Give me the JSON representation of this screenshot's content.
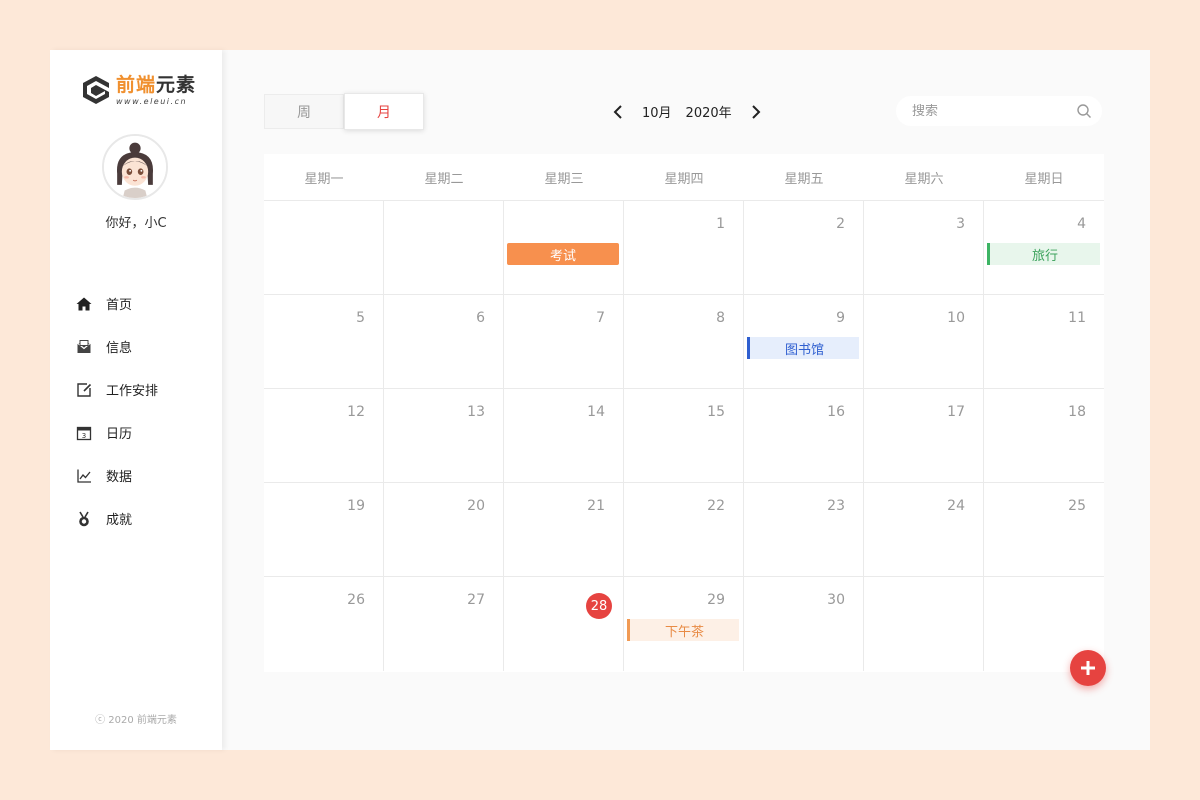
{
  "brand": {
    "title_hl": "前端",
    "title_rest": "元素",
    "subtitle": "www.eleui.cn",
    "accent": "#f0902f"
  },
  "user": {
    "greeting": "你好，小C"
  },
  "nav": {
    "items": [
      {
        "label": "首页",
        "icon": "home-icon"
      },
      {
        "label": "信息",
        "icon": "mail-icon"
      },
      {
        "label": "工作安排",
        "icon": "edit-schedule-icon"
      },
      {
        "label": "日历",
        "icon": "calendar-icon"
      },
      {
        "label": "数据",
        "icon": "chart-icon"
      },
      {
        "label": "成就",
        "icon": "medal-icon"
      }
    ]
  },
  "footer": {
    "copyright": "ⓒ 2020  前端元素"
  },
  "toolbar": {
    "week_label": "周",
    "month_label": "月",
    "current_month": "10月",
    "current_year": "2020年",
    "search_placeholder": "搜索"
  },
  "calendar": {
    "weekdays": [
      "星期一",
      "星期二",
      "星期三",
      "星期四",
      "星期五",
      "星期六",
      "星期日"
    ],
    "cells": [
      {
        "day": "",
        "event": null
      },
      {
        "day": "",
        "event": null
      },
      {
        "day": "",
        "event": "考试",
        "event_type": "exam"
      },
      {
        "day": "1"
      },
      {
        "day": "2"
      },
      {
        "day": "3"
      },
      {
        "day": "4",
        "event": "旅行",
        "event_type": "travel"
      },
      {
        "day": "5"
      },
      {
        "day": "6"
      },
      {
        "day": "7"
      },
      {
        "day": "8"
      },
      {
        "day": "9",
        "event": "图书馆",
        "event_type": "library"
      },
      {
        "day": "10"
      },
      {
        "day": "11"
      },
      {
        "day": "12"
      },
      {
        "day": "13"
      },
      {
        "day": "14"
      },
      {
        "day": "15"
      },
      {
        "day": "16"
      },
      {
        "day": "17"
      },
      {
        "day": "18"
      },
      {
        "day": "19"
      },
      {
        "day": "20"
      },
      {
        "day": "21"
      },
      {
        "day": "22"
      },
      {
        "day": "23"
      },
      {
        "day": "24"
      },
      {
        "day": "25"
      },
      {
        "day": "26"
      },
      {
        "day": "27"
      },
      {
        "day": "28",
        "today": true
      },
      {
        "day": "29",
        "event": "下午茶",
        "event_type": "tea"
      },
      {
        "day": "30"
      },
      {
        "day": ""
      },
      {
        "day": ""
      }
    ]
  },
  "colors": {
    "primary_red": "#e64340",
    "background": "#fde8d8"
  }
}
